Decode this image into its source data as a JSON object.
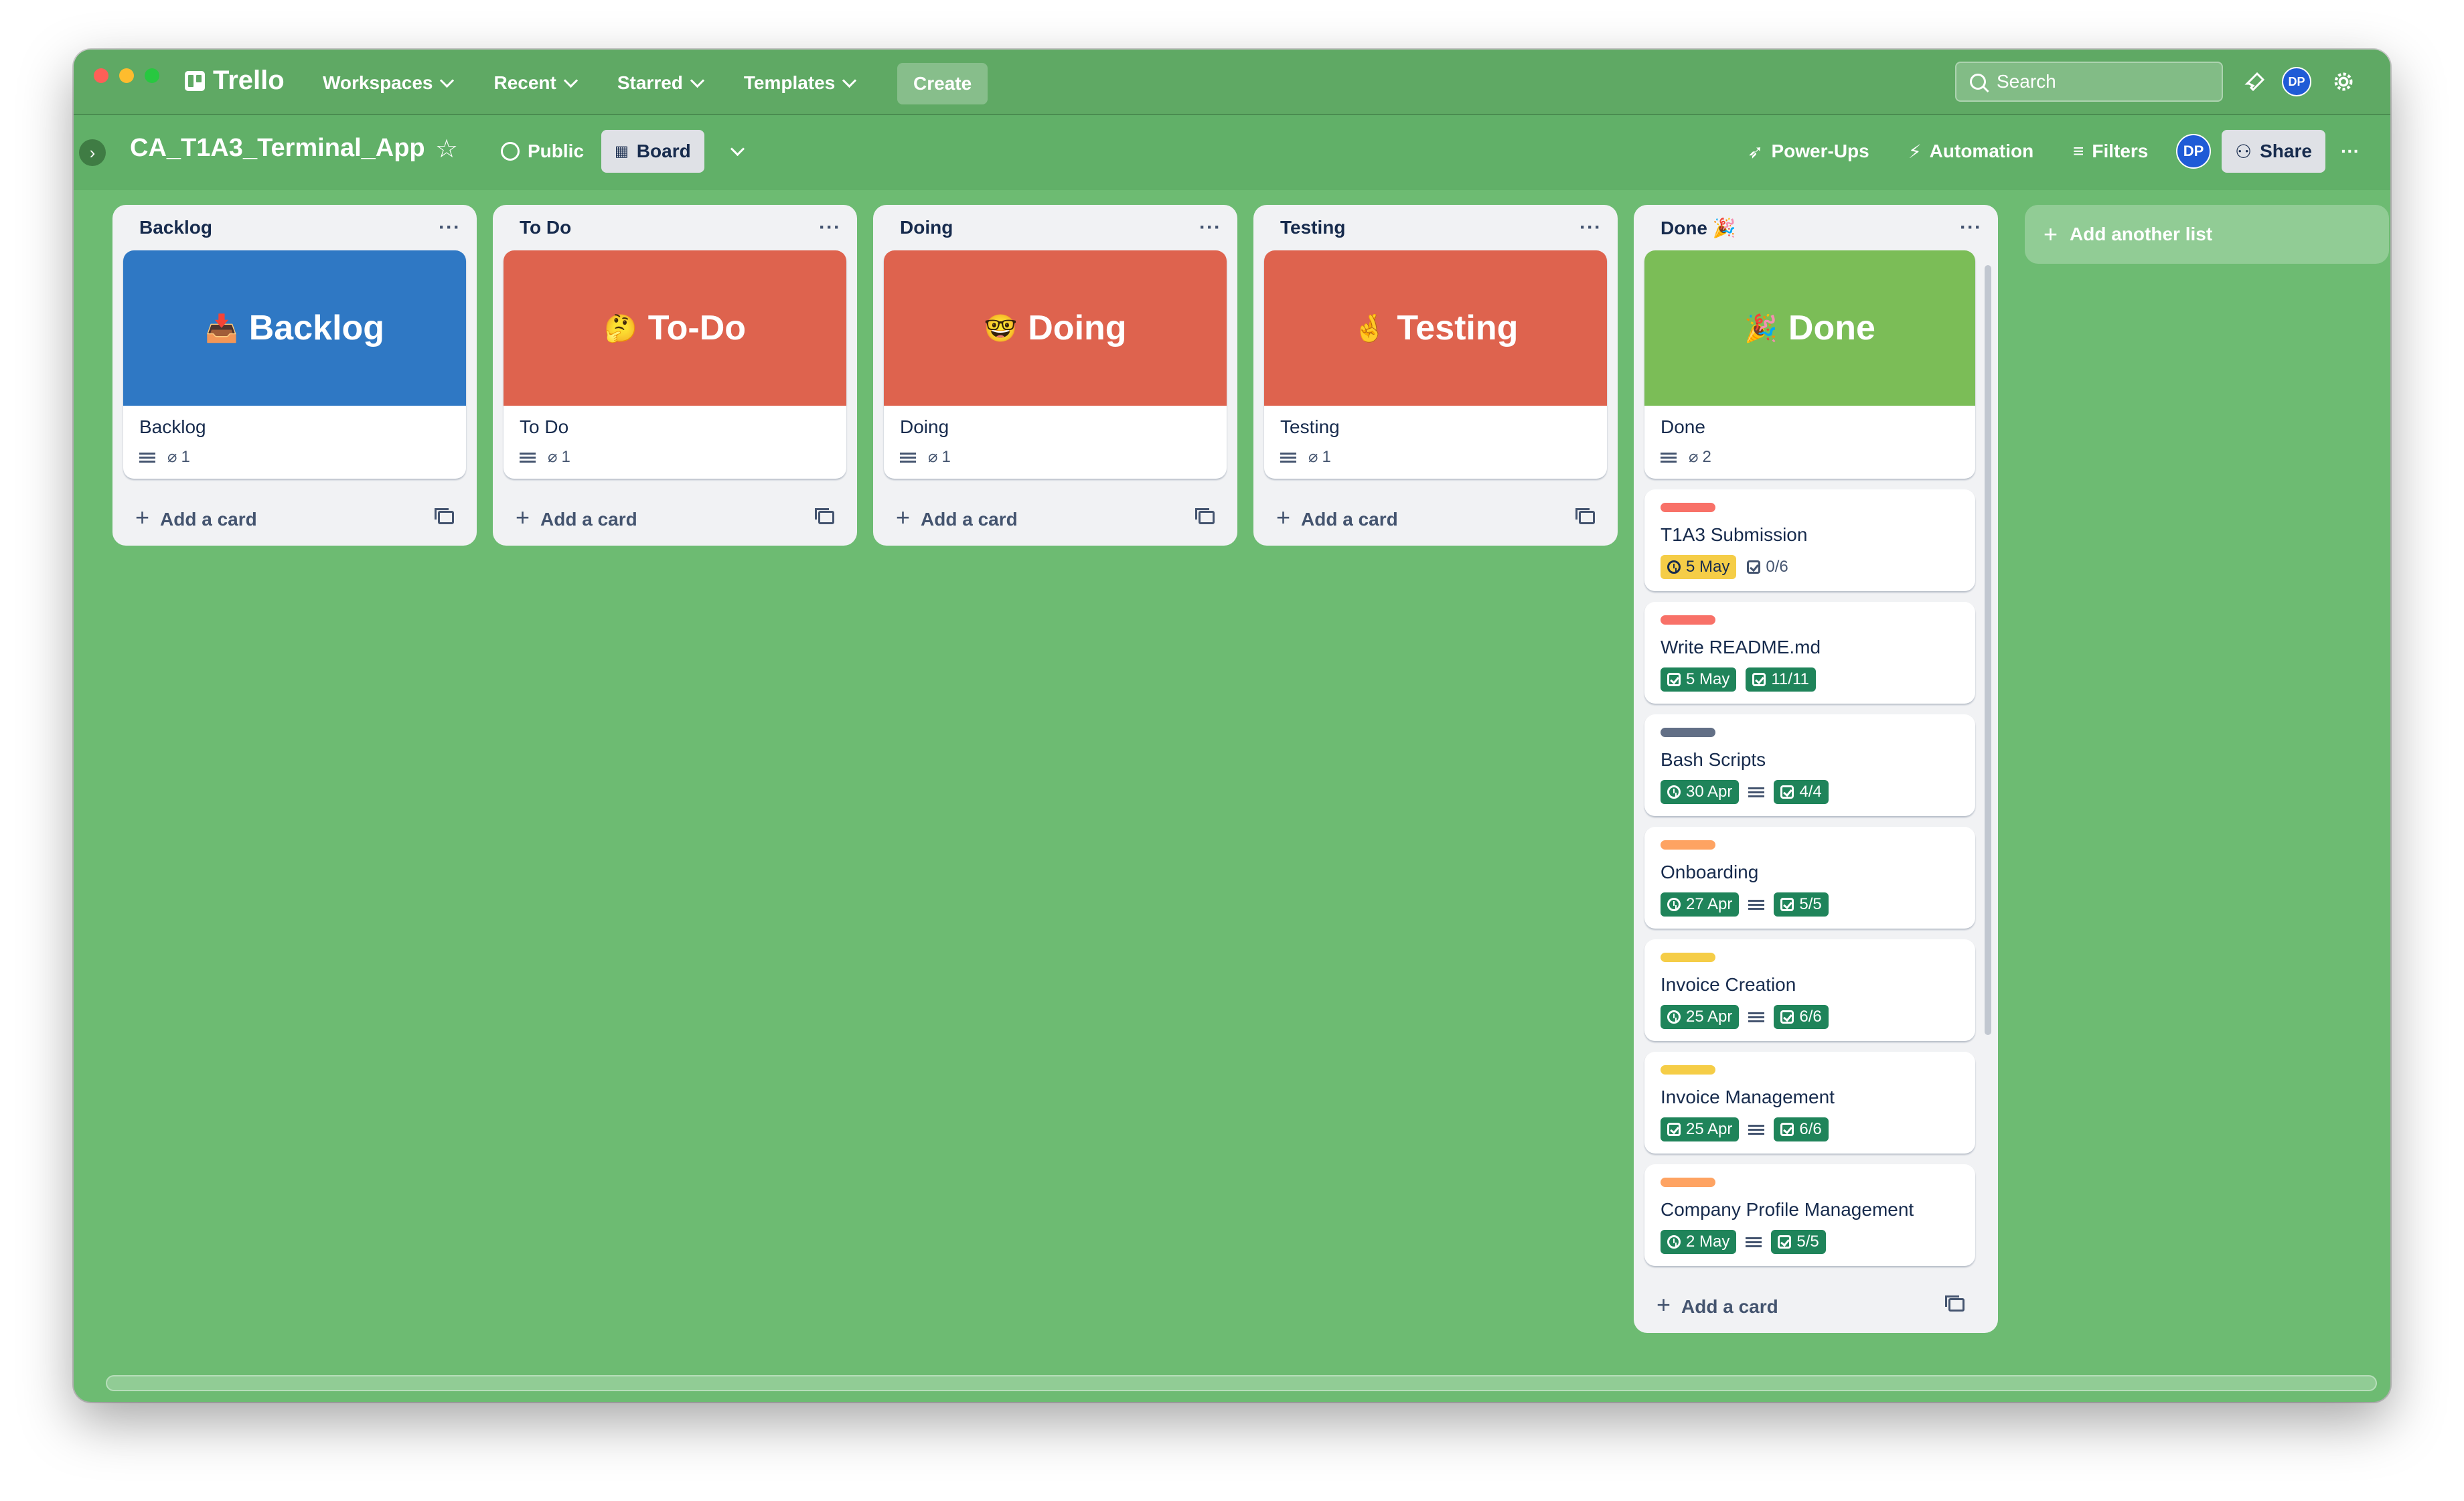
{
  "app": {
    "logo_text": "Trello"
  },
  "nav": {
    "menus": [
      "Workspaces",
      "Recent",
      "Starred",
      "Templates"
    ],
    "create_label": "Create",
    "search_placeholder": "Search",
    "avatar_initials": "DP"
  },
  "board": {
    "title": "CA_T1A3_Terminal_App",
    "visibility": "Public",
    "view": "Board",
    "power_ups": "Power-Ups",
    "automation": "Automation",
    "filters": "Filters",
    "share": "Share",
    "member_initials": "DP",
    "add_list": "Add another list"
  },
  "lists": [
    {
      "name": "Backlog",
      "add_card": "Add a card",
      "cover": {
        "title": "Backlog",
        "emoji": "📥",
        "color": "#2f78c4"
      },
      "cover_card": {
        "title": "Backlog",
        "attachments": "1"
      }
    },
    {
      "name": "To Do",
      "add_card": "Add a card",
      "cover": {
        "title": "To-Do",
        "emoji": "🤔",
        "color": "#de634e"
      },
      "cover_card": {
        "title": "To Do",
        "attachments": "1"
      }
    },
    {
      "name": "Doing",
      "add_card": "Add a card",
      "cover": {
        "title": "Doing",
        "emoji": "🤓",
        "color": "#de634e"
      },
      "cover_card": {
        "title": "Doing",
        "attachments": "1"
      }
    },
    {
      "name": "Testing",
      "add_card": "Add a card",
      "cover": {
        "title": "Testing",
        "emoji": "🤞",
        "color": "#de634e"
      },
      "cover_card": {
        "title": "Testing",
        "attachments": "1"
      }
    },
    {
      "name": "Done 🎉",
      "add_card": "Add a card",
      "cover": {
        "title": "Done",
        "emoji": "🎉",
        "color": "#7bbd57"
      },
      "cover_card": {
        "title": "Done",
        "attachments": "2"
      },
      "cards": [
        {
          "label_color": "#f87168",
          "title": "T1A3 Submission",
          "date": "5 May",
          "date_style": "yellow",
          "date_icon": "clock-icon",
          "has_desc": false,
          "checklist": "0/6",
          "checklist_style": "plain"
        },
        {
          "label_color": "#f87168",
          "title": "Write README.md",
          "date": "5 May",
          "date_style": "green",
          "date_icon": "checkbox-icon",
          "has_desc": false,
          "checklist": "11/11",
          "checklist_style": "green"
        },
        {
          "label_color": "#626f86",
          "title": "Bash Scripts",
          "date": "30 Apr",
          "date_style": "green",
          "date_icon": "clock-icon",
          "has_desc": true,
          "checklist": "4/4",
          "checklist_style": "green"
        },
        {
          "label_color": "#fea362",
          "title": "Onboarding",
          "date": "27 Apr",
          "date_style": "green",
          "date_icon": "clock-icon",
          "has_desc": true,
          "checklist": "5/5",
          "checklist_style": "green"
        },
        {
          "label_color": "#f5cd47",
          "title": "Invoice Creation",
          "date": "25 Apr",
          "date_style": "green",
          "date_icon": "clock-icon",
          "has_desc": true,
          "checklist": "6/6",
          "checklist_style": "green"
        },
        {
          "label_color": "#f5cd47",
          "title": "Invoice Management",
          "date": "25 Apr",
          "date_style": "green",
          "date_icon": "checkbox-icon",
          "has_desc": true,
          "checklist": "6/6",
          "checklist_style": "green"
        },
        {
          "label_color": "#fea362",
          "title": "Company Profile Management",
          "date": "2 May",
          "date_style": "green",
          "date_icon": "clock-icon",
          "has_desc": true,
          "checklist": "5/5",
          "checklist_style": "green"
        }
      ]
    }
  ]
}
